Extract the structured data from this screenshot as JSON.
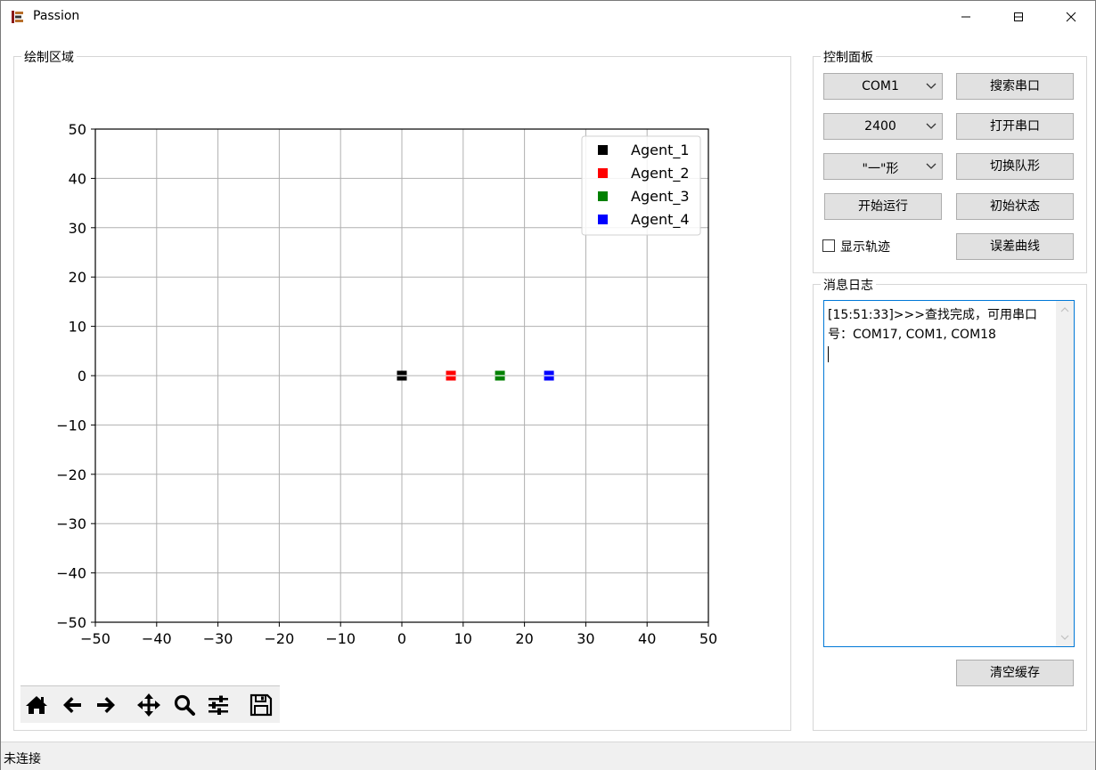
{
  "window": {
    "title": "Passion"
  },
  "plot_group": {
    "title": "绘制区域"
  },
  "control_group": {
    "title": "控制面板"
  },
  "log_group": {
    "title": "消息日志"
  },
  "controls": {
    "port_select": "COM1",
    "baud_select": "2400",
    "formation_select": "\"一\"形",
    "search_port_label": "搜索串口",
    "open_port_label": "打开串口",
    "switch_formation_label": "切换队形",
    "start_run_label": "开始运行",
    "initial_state_label": "初始状态",
    "show_trace_label": "显示轨迹",
    "show_trace_checked": false,
    "error_curve_label": "误差曲线",
    "clear_cache_label": "清空缓存"
  },
  "log": {
    "lines": [
      "[15:51:33]>>>查找完成，可用串口号：COM17, COM1, COM18"
    ]
  },
  "status": {
    "text": "未连接"
  },
  "toolbar_icons": [
    "home-icon",
    "back-arrow-icon",
    "forward-arrow-icon",
    "pan-move-icon",
    "zoom-magnifier-icon",
    "configure-sliders-icon",
    "save-floppy-icon"
  ],
  "chart_data": {
    "type": "scatter",
    "xlim": [
      -50,
      50
    ],
    "ylim": [
      -50,
      50
    ],
    "xticks": [
      -50,
      -40,
      -30,
      -20,
      -10,
      0,
      10,
      20,
      30,
      40,
      50
    ],
    "yticks": [
      -50,
      -40,
      -30,
      -20,
      -10,
      0,
      10,
      20,
      30,
      40,
      50
    ],
    "grid": true,
    "legend_position": "top-right",
    "marker": "square",
    "series": [
      {
        "name": "Agent_1",
        "color": "#000000",
        "points": [
          [
            0,
            0
          ]
        ]
      },
      {
        "name": "Agent_2",
        "color": "#ff0000",
        "points": [
          [
            8,
            0
          ]
        ]
      },
      {
        "name": "Agent_3",
        "color": "#008000",
        "points": [
          [
            16,
            0
          ]
        ]
      },
      {
        "name": "Agent_4",
        "color": "#0000ff",
        "points": [
          [
            24,
            0
          ]
        ]
      }
    ]
  }
}
